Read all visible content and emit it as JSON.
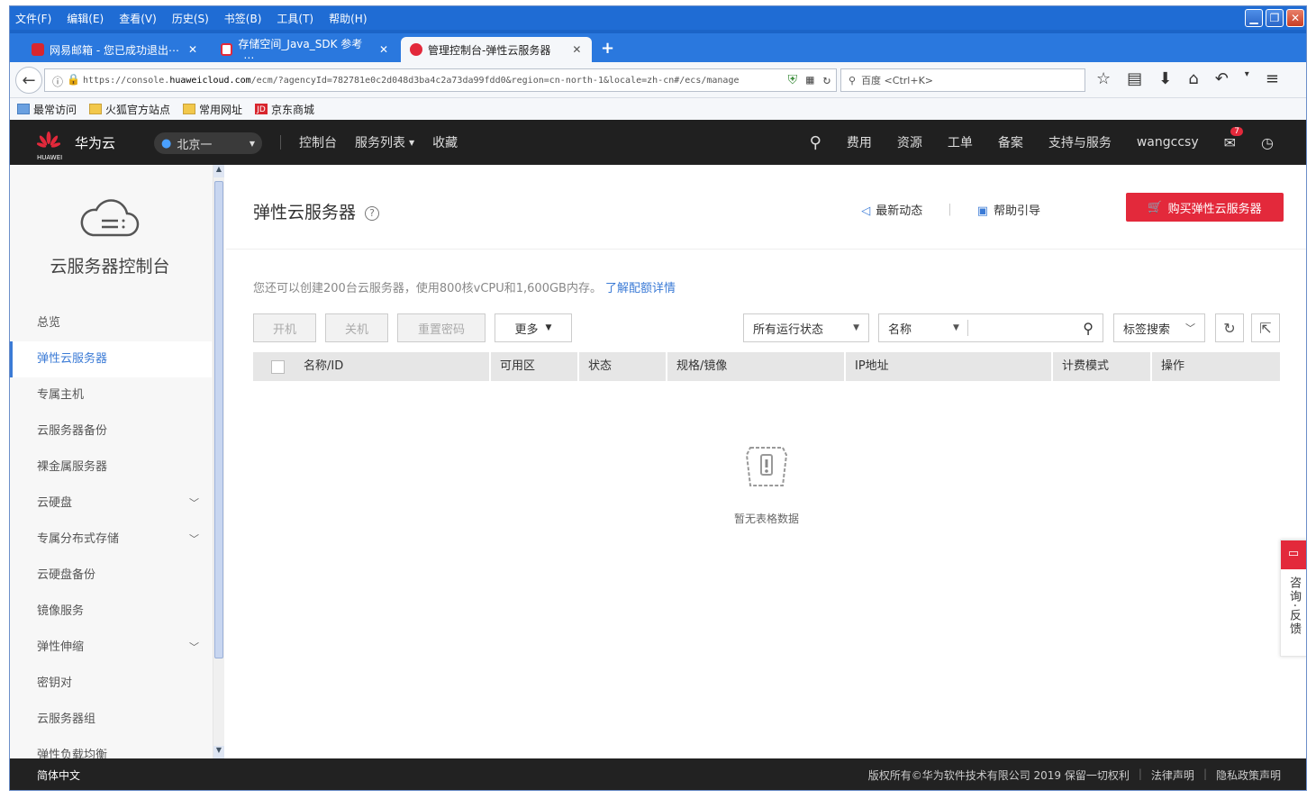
{
  "menubar": [
    "文件(F)",
    "编辑(E)",
    "查看(V)",
    "历史(S)",
    "书签(B)",
    "工具(T)",
    "帮助(H)"
  ],
  "tabs": [
    {
      "title": "网易邮箱 - 您已成功退出⋯"
    },
    {
      "title": "存储空间_Java_SDK 参考_⋯"
    },
    {
      "title": "管理控制台-弹性云服务器"
    }
  ],
  "url": {
    "prefix": "https://console.",
    "host": "huaweicloud.com",
    "rest": "/ecm/?agencyId=782781e0c2d048d3ba4c2a73da99fdd0&region=cn-north-1&locale=zh-cn#/ecs/manage"
  },
  "search": {
    "placeholder": "百度 <Ctrl+K>"
  },
  "bookmarks": [
    "最常访问",
    "火狐官方站点",
    "常用网址",
    "京东商城"
  ],
  "topnav": {
    "brand": "华为云",
    "logo_sub": "HUAWEI",
    "region": "北京一",
    "links": [
      "控制台",
      "服务列表",
      "收藏"
    ],
    "right": [
      "费用",
      "资源",
      "工单",
      "备案",
      "支持与服务",
      "wangccsy"
    ],
    "badge": "7"
  },
  "sidebar": {
    "title": "云服务器控制台",
    "items": [
      {
        "label": "总览"
      },
      {
        "label": "弹性云服务器"
      },
      {
        "label": "专属主机"
      },
      {
        "label": "云服务器备份"
      },
      {
        "label": "裸金属服务器"
      },
      {
        "label": "云硬盘"
      },
      {
        "label": "专属分布式存储"
      },
      {
        "label": "云硬盘备份"
      },
      {
        "label": "镜像服务"
      },
      {
        "label": "弹性伸缩"
      },
      {
        "label": "密钥对"
      },
      {
        "label": "云服务器组"
      },
      {
        "label": "弹性负载均衡"
      }
    ]
  },
  "main": {
    "title": "弹性云服务器",
    "link_news": "最新动态",
    "link_help": "帮助引导",
    "buy_label": "购买弹性云服务器",
    "quota_text": "您还可以创建200台云服务器，使用800核vCPU和1,600GB内存。",
    "quota_link": "了解配额详情",
    "btn_start": "开机",
    "btn_stop": "关机",
    "btn_reset": "重置密码",
    "btn_more": "更多",
    "filter_status": "所有运行状态",
    "filter_field": "名称",
    "tag_search": "标签搜索",
    "columns": [
      "名称/ID",
      "可用区",
      "状态",
      "规格/镜像",
      "IP地址",
      "计费模式",
      "操作"
    ],
    "empty_text": "暂无表格数据"
  },
  "footer": {
    "lang": "简体中文",
    "copyright": "版权所有©华为软件技术有限公司 2019 保留一切权利",
    "legal": "法律声明",
    "privacy": "隐私政策声明"
  },
  "feedback": {
    "label": "咨询·反馈"
  },
  "colors": {
    "accent": "#3b7bd6",
    "danger": "#e3293b",
    "topnav": "#202020"
  }
}
